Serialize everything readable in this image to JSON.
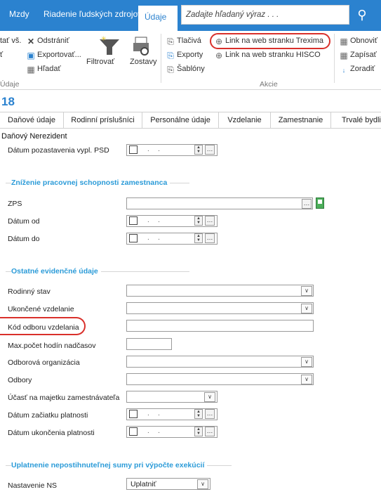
{
  "menubar": {
    "items": [
      "Mzdy",
      "Riadenie ľudských zdrojov",
      "Údaje"
    ],
    "search_placeholder": "Zadajte hľadaný výraz . . ."
  },
  "ribbon": {
    "col1": [
      "tať vš.",
      "ť"
    ],
    "remove": "Odstrániť",
    "export": "Exportovať...",
    "find": "Hľadať",
    "filter": "Filtrovať",
    "reports": "Zostavy",
    "group_udaje": "Údaje",
    "print": "Tlačivá",
    "exports": "Exporty",
    "templates": "Šablóny",
    "link_trexima": "Link na web stranku Trexima",
    "link_hisco": "Link na web stranku HISCO",
    "group_akcie": "Akcie",
    "refresh": "Obnoviť",
    "write": "Zapísať",
    "sort": "Zoradiť"
  },
  "record_number": "18",
  "tabs": [
    "Daňové údaje",
    "Rodinní príslušníci",
    "Personálne údaje",
    "Vzdelanie",
    "Zamestnanie",
    "Trvalé bydlis"
  ],
  "subheader": "Daňový Nerezident",
  "form": {
    "psd_label": "Dátum pozastavenia vypl. PSD",
    "section1": "Zníženie pracovnej schopnosti zamestnanca",
    "zps_label": "ZPS",
    "date_from": "Dátum od",
    "date_to": "Dátum do",
    "section2": "Ostatné evidenčné údaje",
    "marital": "Rodinný stav",
    "education": "Ukončené vzdelanie",
    "edu_code": "Kód odboru vzdelania",
    "max_hours": "Max.počet hodín nadčasov",
    "union_org": "Odborová organizácia",
    "unions": "Odbory",
    "employer_share": "Účasť na majetku zamestnávateľa",
    "validity_start": "Dátum začiatku  platnosti",
    "validity_end": "Dátum ukončenia platnosti",
    "section3": "Uplatnenie nepostihnuteľnej sumy pri výpočte exekúcií",
    "ns_label": "Nastavenie NS",
    "ns_value": "Uplatniť"
  },
  "colors": {
    "accent": "#2b82cf",
    "highlight": "#d9302b"
  }
}
